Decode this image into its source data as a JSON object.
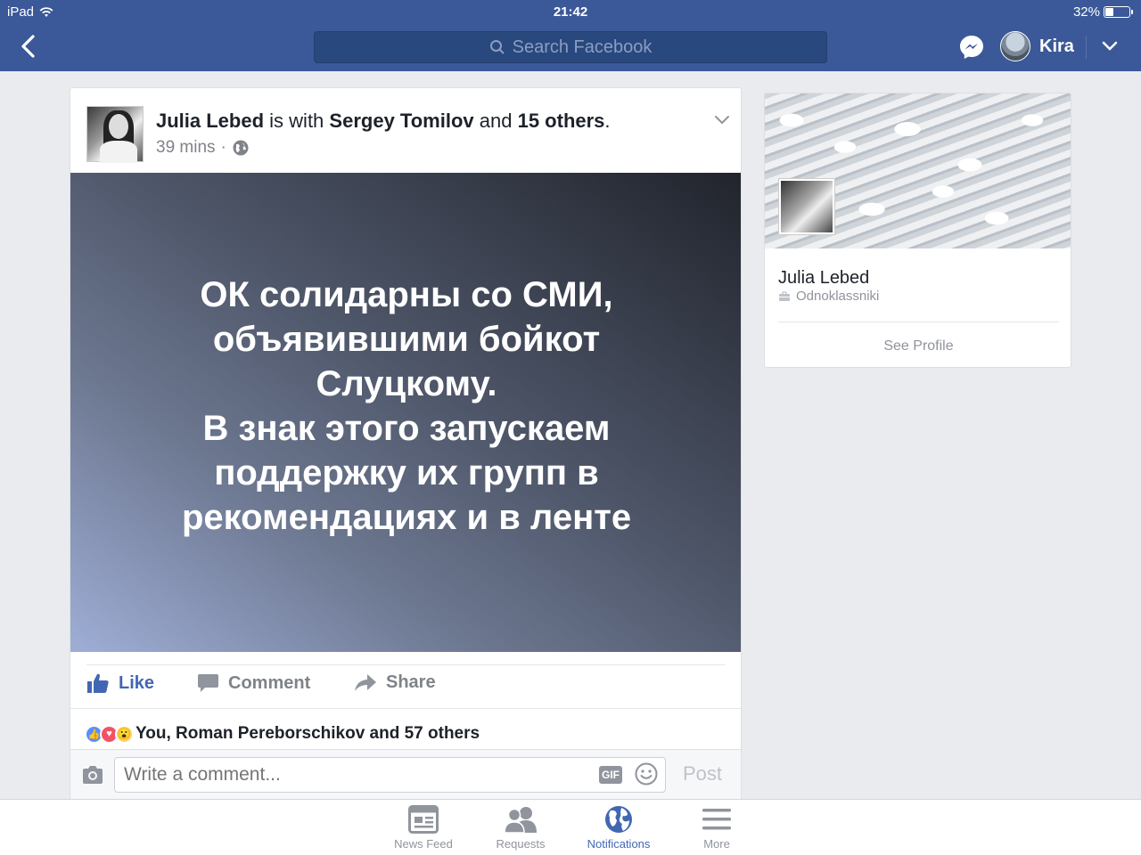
{
  "status_bar": {
    "device": "iPad",
    "time": "21:42",
    "battery": "32%"
  },
  "header": {
    "search_placeholder": "Search Facebook",
    "user_name": "Kira"
  },
  "post": {
    "author": "Julia Lebed",
    "with_text": "is with",
    "tagged": "Sergey Tomilov",
    "and_text": "and",
    "others": "15 others",
    "period": ".",
    "time": "39 mins",
    "dot": "·",
    "body": "ОК солидарны со СМИ,\nобъявившими бойкот\nСлуцкому.\nВ знак этого запускаем\nподдержку их групп в\nрекомендациях и в ленте",
    "actions": {
      "like": "Like",
      "comment": "Comment",
      "share": "Share"
    },
    "reactions_text": "You, Roman  Pereborschikov and 57 others",
    "comment_placeholder": "Write a comment...",
    "gif_label": "GIF",
    "post_label": "Post"
  },
  "profile_card": {
    "name": "Julia Lebed",
    "workplace": "Odnoklassniki",
    "see_profile": "See Profile"
  },
  "tabs": [
    {
      "label": "News Feed",
      "icon": "news-feed-icon"
    },
    {
      "label": "Requests",
      "icon": "requests-icon"
    },
    {
      "label": "Notifications",
      "icon": "globe-icon"
    },
    {
      "label": "More",
      "icon": "hamburger-menu-icon"
    }
  ],
  "colors": {
    "brand": "#3b5998",
    "accent": "#4267b2",
    "muted": "#90949c"
  }
}
